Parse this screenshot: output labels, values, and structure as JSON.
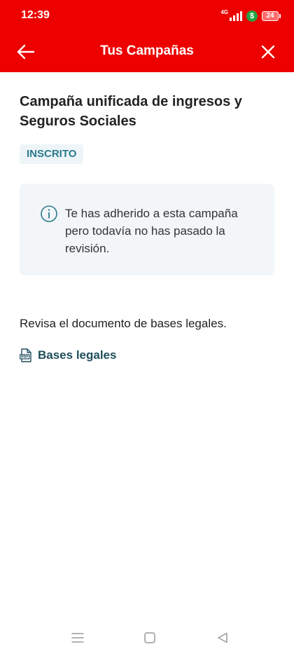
{
  "status_bar": {
    "time": "12:39",
    "network": "4G",
    "battery": "24"
  },
  "header": {
    "title": "Tus Campañas"
  },
  "campaign": {
    "title": "Campaña unificada de ingresos y Seguros Sociales",
    "status": "INSCRITO"
  },
  "info": {
    "message": "Te has adherido a esta campaña pero todavía no has pasado la revisión."
  },
  "legal": {
    "description": "Revisa el documento de bases legales.",
    "link_label": "Bases legales",
    "pdf_icon_text": "PDF"
  },
  "colors": {
    "brand_red": "#ec0000",
    "badge_text": "#2b7a8c",
    "badge_bg": "#eef5f8",
    "card_bg": "#f2f6f9",
    "link": "#1f4e5c"
  },
  "icons": [
    "back-arrow-icon",
    "close-icon",
    "info-icon",
    "pdf-icon",
    "signal-icon",
    "money-icon",
    "battery-icon",
    "menu-icon",
    "home-icon",
    "back-nav-icon"
  ]
}
